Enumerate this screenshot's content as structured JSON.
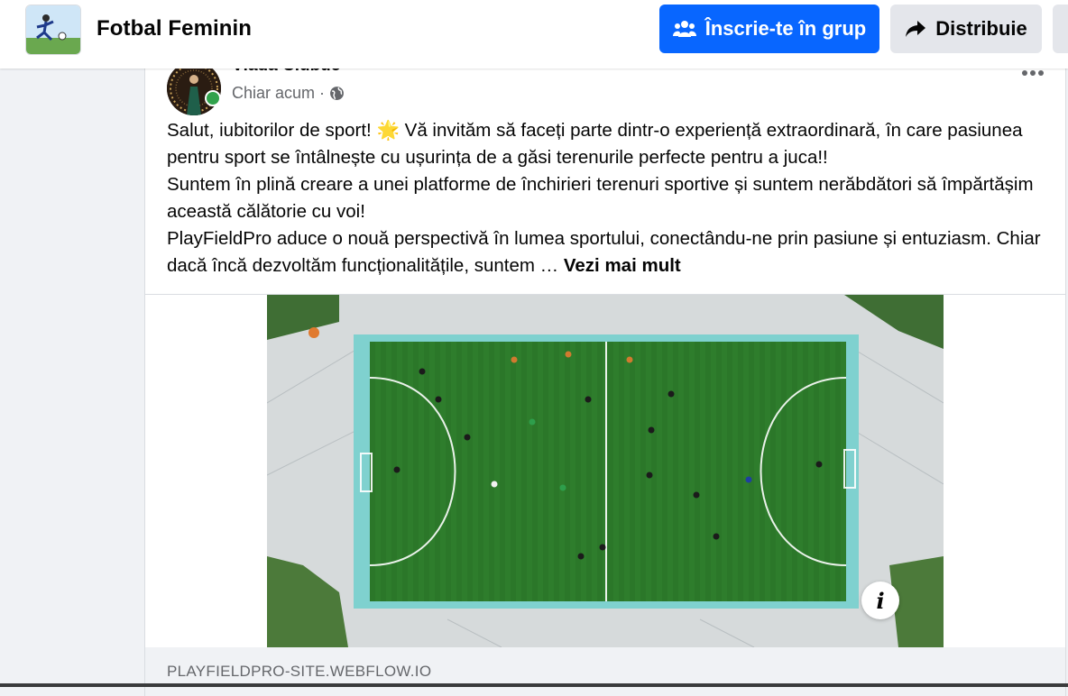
{
  "header": {
    "group_name": "Fotbal Feminin",
    "join_label": "Înscrie-te în grup",
    "share_label": "Distribuie"
  },
  "post": {
    "author": "Vlada Ciubuc",
    "time": "Chiar acum",
    "visibility_icon": "globe-icon",
    "paragraphs": [
      "Salut, iubitorilor de sport! 🌟 Vă invităm să faceți parte dintr-o experiență extraordinară, în care pasiunea pentru sport se întâlnește cu ușurința de a găsi terenurile perfecte pentru a juca!!",
      "Suntem în plină creare a unei platforme  de închirieri terenuri sportive și suntem nerăbdători să împărtășim această călătorie cu voi!",
      "PlayFieldPro aduce o nouă perspectivă în lumea sportului, conectându-ne prin pasiune și entuziasm. Chiar dacă încă dezvoltăm funcționalitățile, suntem …"
    ],
    "see_more": "Vezi mai mult",
    "link_domain": "PLAYFIELDPRO-SITE.WEBFLOW.IO"
  },
  "colors": {
    "primary": "#0866ff",
    "background": "#f0f2f5",
    "secondary_button": "#e4e6eb",
    "online": "#31a24c",
    "pitch": "#2d7a2a"
  }
}
